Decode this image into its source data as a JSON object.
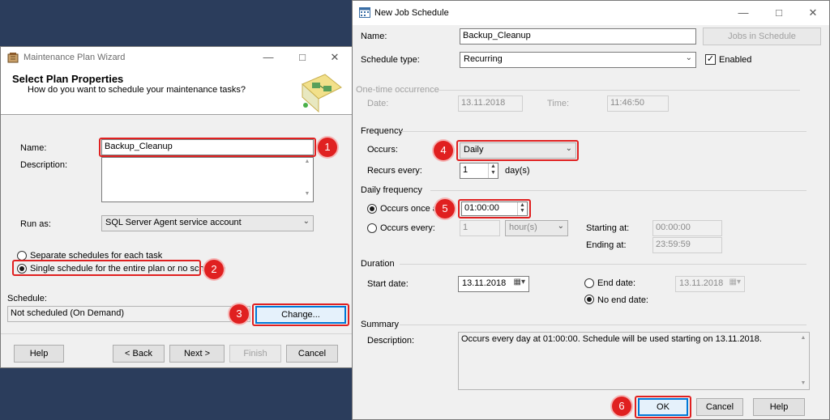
{
  "wizard": {
    "title": "Maintenance Plan Wizard",
    "heading": "Select Plan Properties",
    "subheading": "How do you want to schedule your maintenance tasks?",
    "name_label": "Name:",
    "name_value": "Backup_Cleanup",
    "description_label": "Description:",
    "description_value": "",
    "run_as_label": "Run as:",
    "run_as_value": "SQL Server Agent service account",
    "option_separate": "Separate schedules for each task",
    "option_single": "Single schedule for the entire plan or no schedule",
    "schedule_label": "Schedule:",
    "schedule_value": "Not scheduled (On Demand)",
    "change_button": "Change...",
    "help_button": "Help",
    "back_button": "< Back",
    "next_button": "Next >",
    "finish_button": "Finish",
    "cancel_button": "Cancel"
  },
  "dialog": {
    "title": "New Job Schedule",
    "name_label": "Name:",
    "name_value": "Backup_Cleanup",
    "jobs_button": "Jobs in Schedule",
    "schedule_type_label": "Schedule type:",
    "schedule_type_value": "Recurring",
    "enabled_label": "Enabled",
    "one_time_header": "One-time occurrence",
    "date_label": "Date:",
    "date_value": "13.11.2018",
    "time_label": "Time:",
    "time_value": "11:46:50",
    "frequency_header": "Frequency",
    "occurs_label": "Occurs:",
    "occurs_value": "Daily",
    "recurs_label": "Recurs every:",
    "recurs_value": "1",
    "recurs_unit": "day(s)",
    "daily_header": "Daily frequency",
    "occurs_once_label": "Occurs once at:",
    "occurs_once_value": "01:00:00",
    "occurs_every_label": "Occurs every:",
    "occurs_every_value": "1",
    "occurs_every_unit": "hour(s)",
    "starting_label": "Starting at:",
    "starting_value": "00:00:00",
    "ending_label": "Ending at:",
    "ending_value": "23:59:59",
    "duration_header": "Duration",
    "start_date_label": "Start date:",
    "start_date_value": "13.11.2018",
    "end_date_label": "End date:",
    "end_date_value": "13.11.2018",
    "no_end_label": "No end date:",
    "summary_header": "Summary",
    "summary_label": "Description:",
    "summary_value": "Occurs every day at 01:00:00. Schedule will be used starting on 13.11.2018.",
    "ok_button": "OK",
    "cancel_button": "Cancel",
    "help_button": "Help"
  },
  "badges": [
    "1",
    "2",
    "3",
    "4",
    "5",
    "6"
  ],
  "colors": {
    "annotation": "#e02020",
    "desktop": "#2b3d5c",
    "focus": "#0078d7"
  }
}
